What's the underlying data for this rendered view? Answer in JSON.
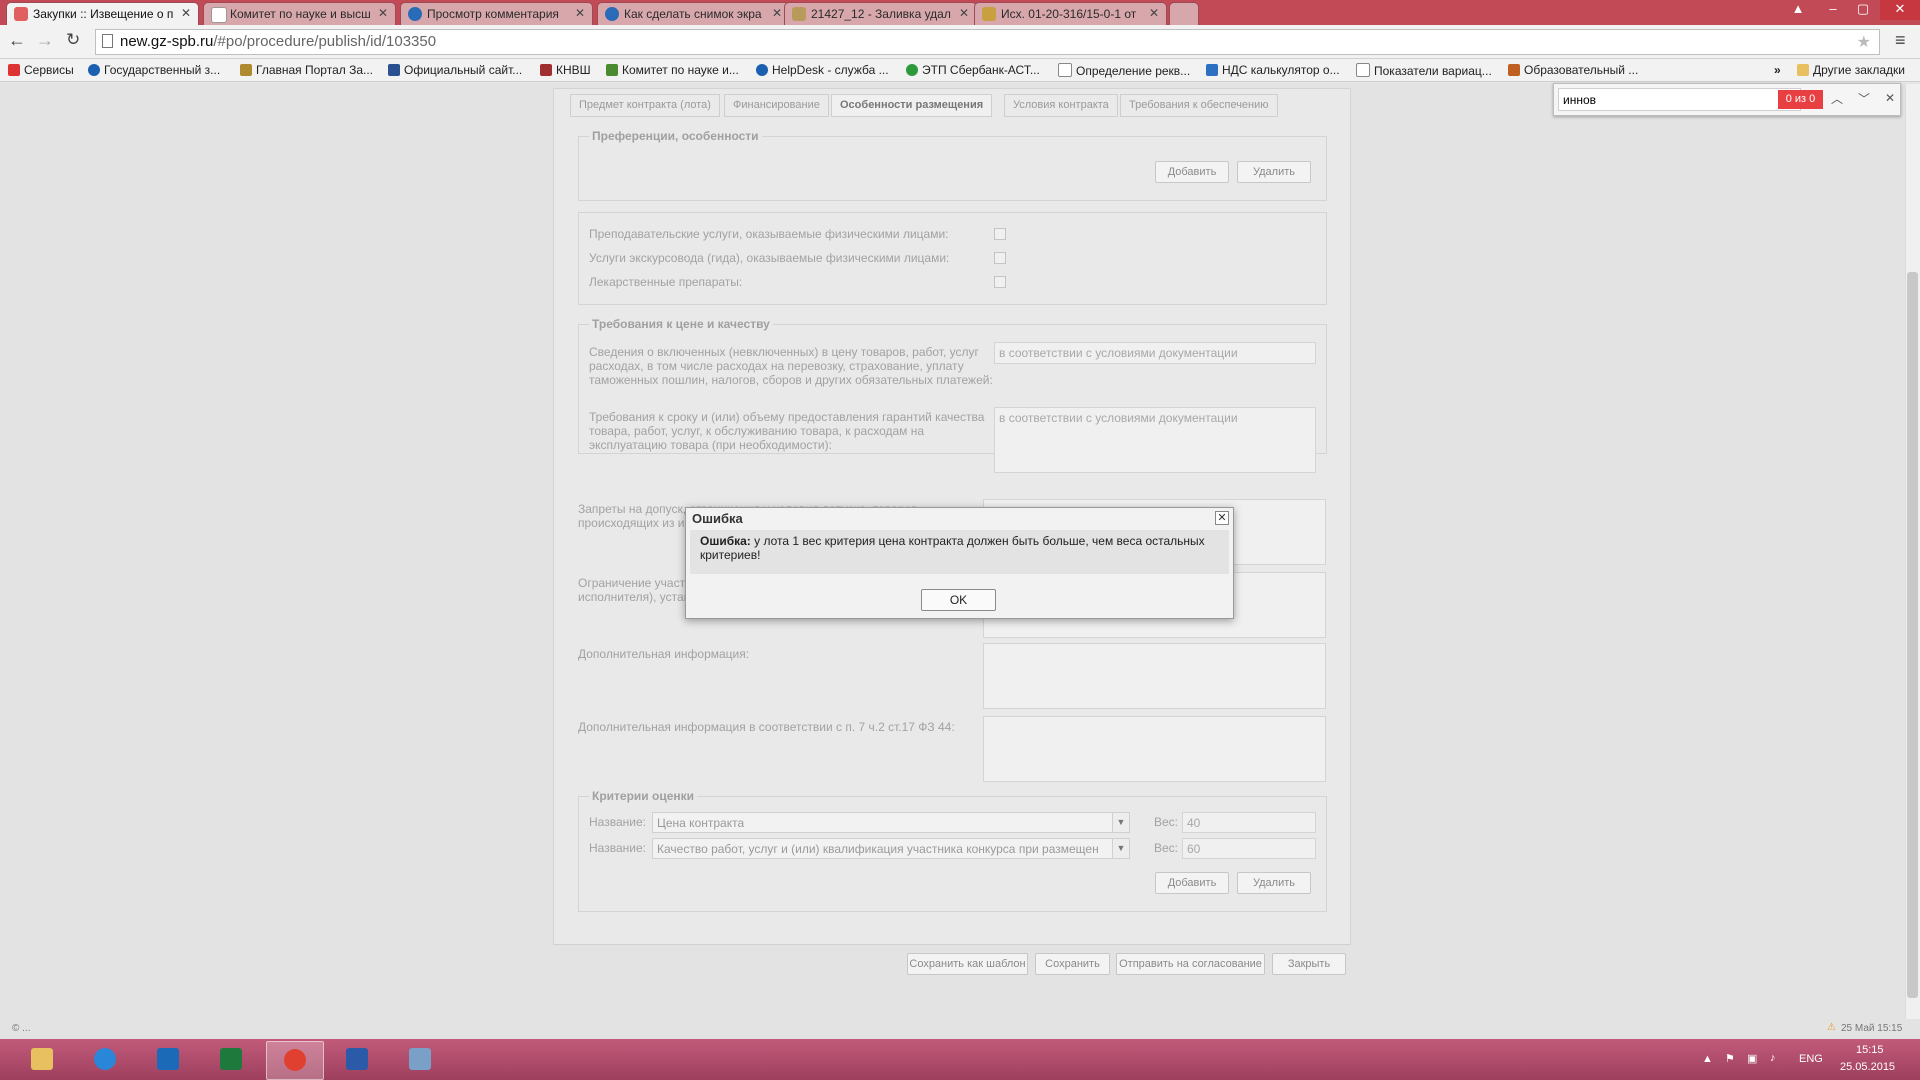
{
  "browser": {
    "tabs": [
      {
        "title": "Закупки :: Извещение о п",
        "active": true
      },
      {
        "title": "Комитет по науке и высш",
        "active": false
      },
      {
        "title": "Просмотр комментария",
        "active": false
      },
      {
        "title": "Как сделать снимок экра",
        "active": false
      },
      {
        "title": "21427_12 - Заливка удал",
        "active": false
      },
      {
        "title": "Исх. 01-20-316/15-0-1 от",
        "active": false
      }
    ],
    "url_host": "new.gz-spb.ru",
    "url_path": "/#po/procedure/publish/id/103350",
    "bookmarks": [
      "Сервисы",
      "Государственный з...",
      "Главная Портал За...",
      "Официальный сайт...",
      "КНВШ",
      "Комитет по науке и...",
      "HelpDesk - служба ...",
      "ЭТП Сбербанк-АСТ...",
      "Определение рекв...",
      "НДС калькулятор о...",
      "Показатели вариац...",
      "Образовательный ..."
    ],
    "bookmarks_more": "»",
    "other_bookmarks": "Другие закладки",
    "find": {
      "query": "иннов",
      "count": "0 из 0"
    }
  },
  "form": {
    "tabs": [
      "Предмет контракта (лота)",
      "Финансирование",
      "Особенности размещения",
      "Условия контракта",
      "Требования к обеспечению"
    ],
    "preferences_legend": "Преференции, особенности",
    "add_label": "Добавить",
    "delete_label": "Удалить",
    "checkbox_rows": [
      "Преподавательские услуги, оказываемые физическими лицами:",
      "Услуги экскурсовода (гида), оказываемые физическими лицами:",
      "Лекарственные препараты:"
    ],
    "price_quality_legend": "Требования к цене и качеству",
    "price_info_label": "Сведения о включенных (невключенных) в цену товаров, работ, услуг расходах, в том числе расходах на перевозку, страхование, уплату таможенных пошлин, налогов, сборов и других обязательных платежей:",
    "price_info_value": "в соответствии с условиями документации",
    "guarantee_label": "Требования к сроку и (или) объему предоставления гарантий качества товара, работ, услуг, к обслуживанию товара, к расходам на эксплуатацию товара (при необходимости):",
    "guarantee_value": "в соответствии с условиями документации",
    "bans_label": "Запреты на допуск, ограничения и условия допуска, товаров, происходящих из иностранных государств, в соответствии со ст",
    "limits_label": "Ограничение участия в определении поставщика (подрядчика, исполнителя), установленное в соответствии с ч.3 ст.42 Федерального",
    "extra_info_label": "Дополнительная информация:",
    "extra_info_44_label": "Дополнительная информация в соответствии с п. 7 ч.2 ст.17 ФЗ 44:",
    "criteria_legend": "Критерии оценки",
    "criteria": [
      {
        "name_label": "Название:",
        "name": "Цена контракта",
        "weight_label": "Вес:",
        "weight": "40"
      },
      {
        "name_label": "Название:",
        "name": "Качество работ, услуг и (или) квалификация участника конкурса при размещен",
        "weight_label": "Вес:",
        "weight": "60"
      }
    ],
    "footer_buttons": [
      "Сохранить как шаблон",
      "Сохранить",
      "Отправить на согласование",
      "Закрыть"
    ]
  },
  "dialog": {
    "title": "Ошибка",
    "message_bold": "Ошибка:",
    "message": " у лота 1 вес критерия цена контракта должен быть больше, чем веса остальных критериев!",
    "ok_label": "OK"
  },
  "statusbar": {
    "left": "© ...",
    "right": "25 Май 15:15"
  },
  "taskbar": {
    "lang": "ENG",
    "time": "15:15",
    "date": "25.05.2015"
  }
}
